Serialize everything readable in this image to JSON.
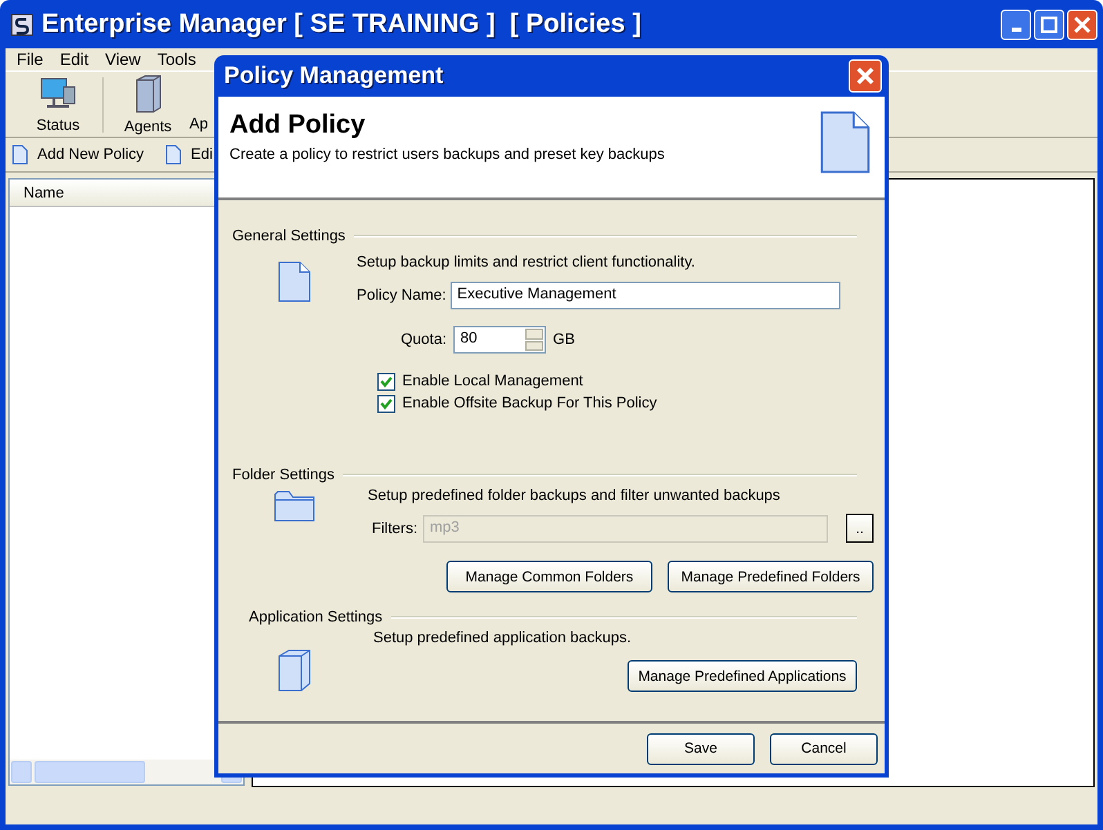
{
  "window": {
    "title": "Enterprise Manager [ SE TRAINING ]  [ Policies ]"
  },
  "menu": [
    "File",
    "Edit",
    "View",
    "Tools"
  ],
  "toolbar": [
    {
      "label": "Status",
      "kind": "monitor"
    },
    {
      "label": "Agents",
      "kind": "server"
    },
    {
      "label": "Ap",
      "kind": "none"
    }
  ],
  "actions": [
    "Add New Policy",
    "Edi"
  ],
  "list": {
    "columns": [
      "Name"
    ]
  },
  "dialog": {
    "title": "Policy Management",
    "heading": "Add Policy",
    "subtitle": "Create a policy to restrict users backups and preset key backups",
    "general": {
      "legend": "General Settings",
      "description": "Setup backup limits and restrict client functionality.",
      "policy_name": {
        "label": "Policy Name:",
        "value": "Executive Management"
      },
      "quota": {
        "label": "Quota:",
        "value": "80",
        "unit": "GB"
      },
      "checkboxes": [
        {
          "label": "Enable Local Management",
          "checked": true
        },
        {
          "label": "Enable Offsite Backup For This Policy",
          "checked": true
        }
      ]
    },
    "folders": {
      "legend": "Folder Settings",
      "description": "Setup predefined folder backups and filter unwanted backups",
      "filters": {
        "label": "Filters:",
        "value": "mp3",
        "disabled": true
      },
      "browse_button": "..",
      "buttons": [
        "Manage Common Folders",
        "Manage Predefined Folders"
      ]
    },
    "applications": {
      "legend": "Application Settings",
      "description": "Setup predefined application backups.",
      "buttons": [
        "Manage Predefined Applications"
      ]
    },
    "buttons": [
      "Save",
      "Cancel"
    ]
  }
}
